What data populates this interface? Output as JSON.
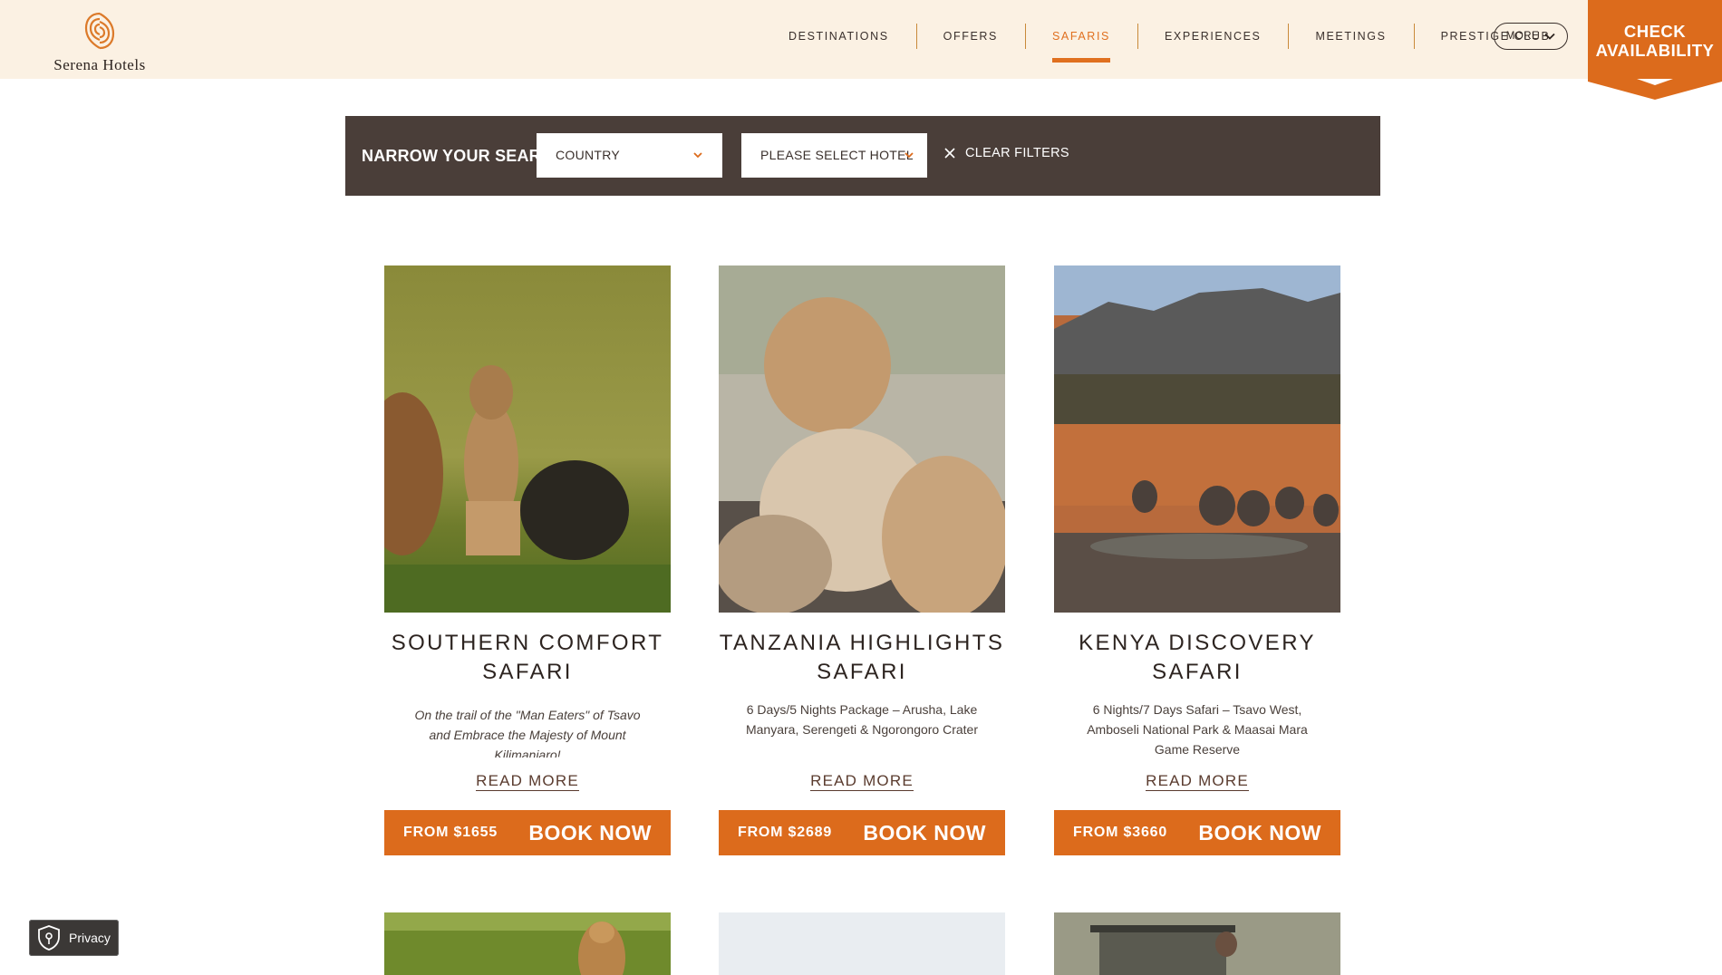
{
  "brand": {
    "name": "Serena Hotels"
  },
  "nav": {
    "items": [
      {
        "label": "DESTINATIONS",
        "active": false
      },
      {
        "label": "OFFERS",
        "active": false
      },
      {
        "label": "SAFARIS",
        "active": true
      },
      {
        "label": "EXPERIENCES",
        "active": false
      },
      {
        "label": "MEETINGS",
        "active": false
      },
      {
        "label": "PRESTIGE CLUB",
        "active": false
      }
    ],
    "more_label": "MORE"
  },
  "check_availability": {
    "line1": "CHECK",
    "line2": "AVAILABILITY"
  },
  "filter": {
    "title": "NARROW YOUR SEARCH",
    "country_value": "COUNTRY",
    "hotel_value": "PLEASE SELECT HOTEL",
    "clear_label": "CLEAR FILTERS"
  },
  "cards": [
    {
      "title": "SOUTHERN COMFORT SAFARI",
      "description": "On the trail of the \"Man Eaters\" of Tsavo and Embrace the Majesty of Mount Kilimanjaro!",
      "read_more": "READ MORE",
      "price": "FROM $1655",
      "book": "BOOK NOW"
    },
    {
      "title": "TANZANIA HIGHLIGHTS SAFARI",
      "description": "6 Days/5 Nights Package – Arusha, Lake Manyara, Serengeti & Ngorongoro Crater",
      "read_more": "READ MORE",
      "price": "FROM $2689",
      "book": "BOOK NOW"
    },
    {
      "title": "KENYA DISCOVERY SAFARI",
      "description": "6 Nights/7 Days Safari – Tsavo West, Amboseli National Park & Maasai Mara Game Reserve",
      "read_more": "READ MORE",
      "price": "FROM $3660",
      "book": "BOOK NOW"
    }
  ],
  "privacy": {
    "label": "Privacy"
  },
  "colors": {
    "accent": "#dc6b1c",
    "header_bg": "#fbf1e3",
    "filter_bg": "#4a3e39",
    "text_dark": "#2d2420"
  },
  "icons": [
    "serena-logo-icon",
    "chevron-down-icon",
    "close-icon",
    "shield-icon"
  ]
}
